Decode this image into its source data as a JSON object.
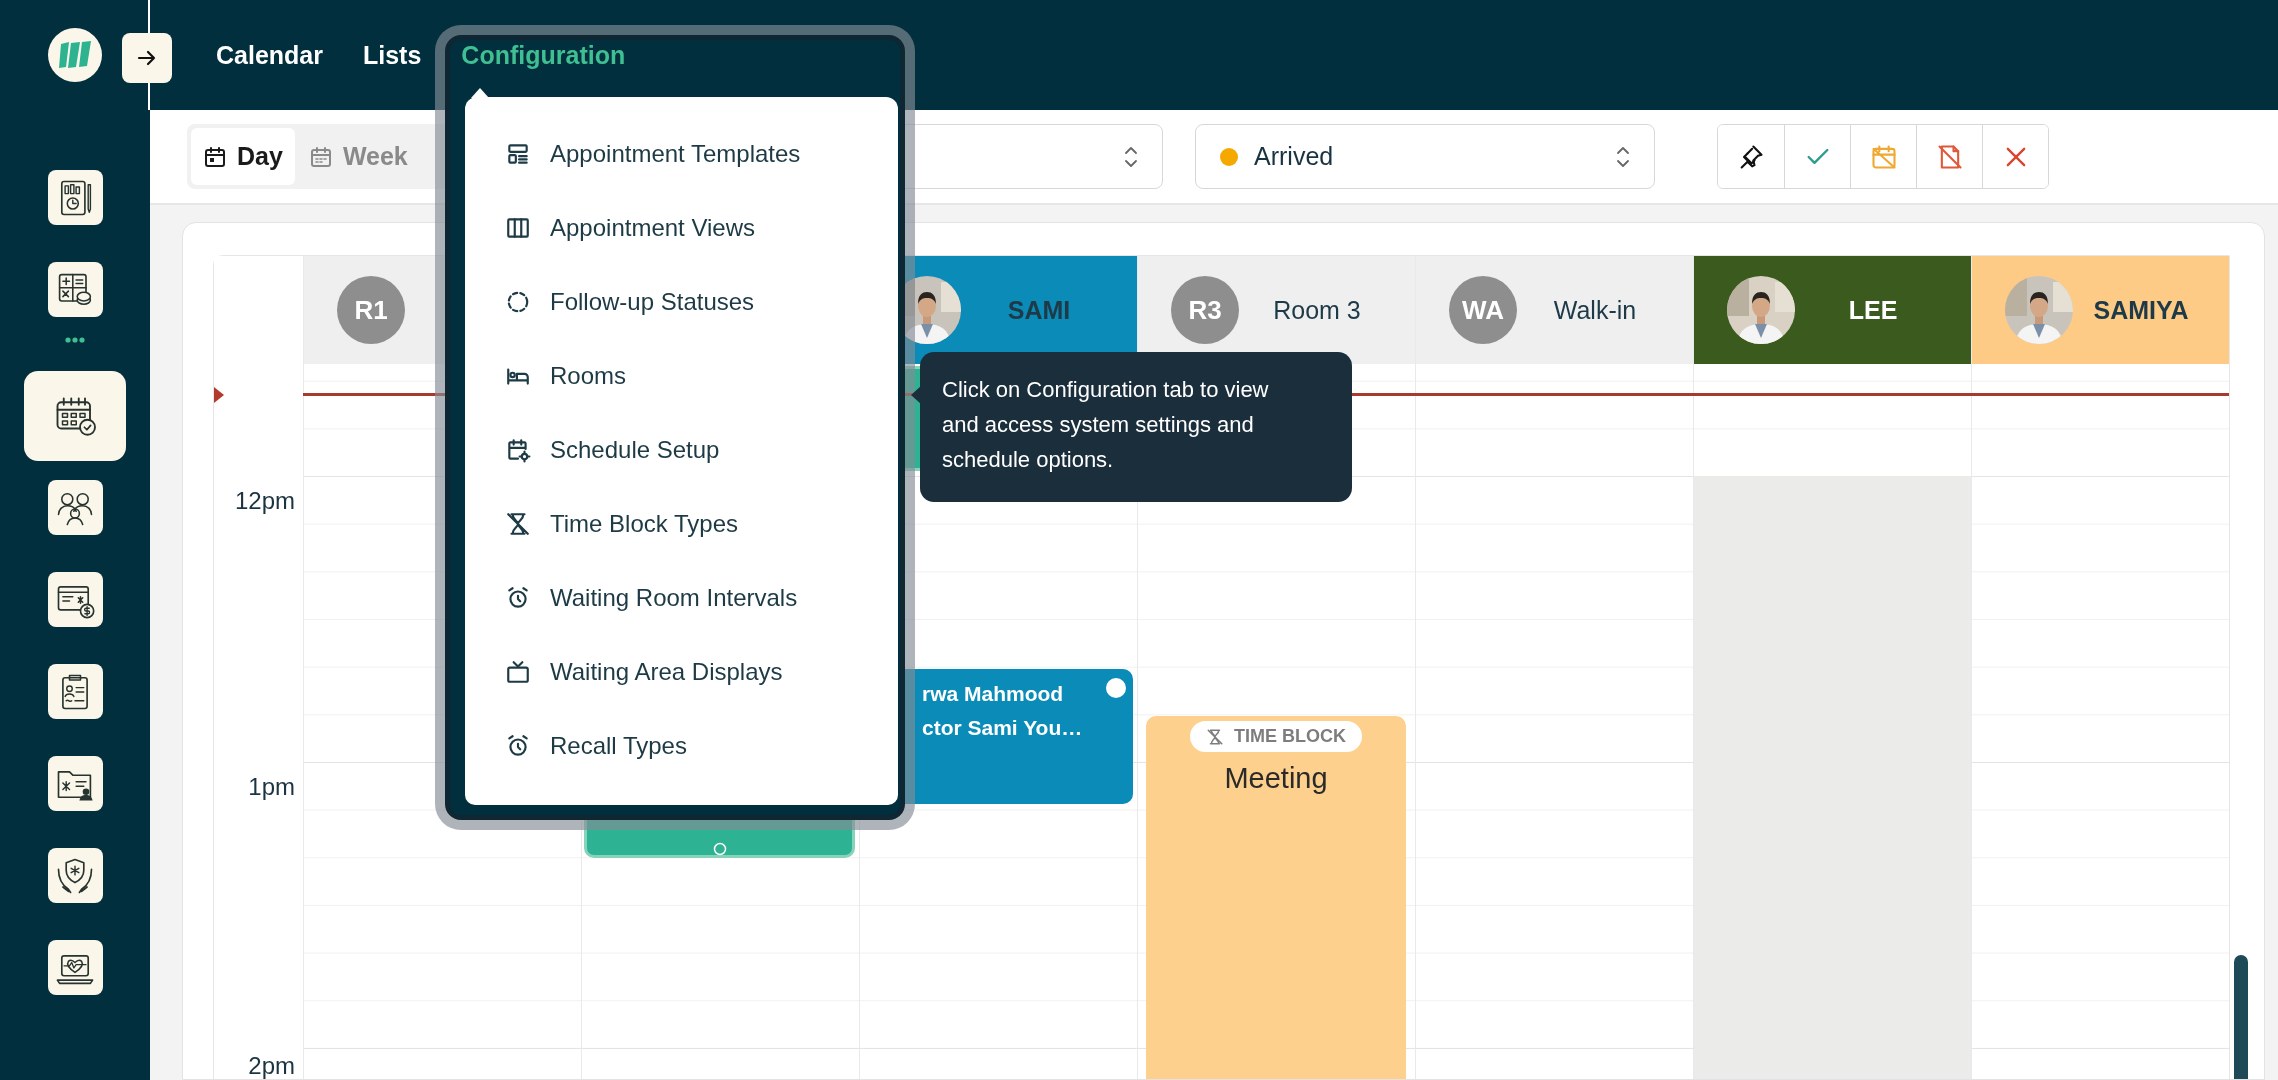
{
  "top_nav": [
    {
      "label": "Calendar",
      "selected": false
    },
    {
      "label": "Lists",
      "selected": false
    },
    {
      "label": "Configuration",
      "selected": true
    }
  ],
  "sidebar": {
    "items": [
      {
        "kind": "tile",
        "selected": false
      },
      {
        "kind": "tile",
        "selected": false
      },
      {
        "kind": "more"
      },
      {
        "kind": "tile",
        "selected": true
      },
      {
        "kind": "tile",
        "selected": false
      },
      {
        "kind": "tile",
        "selected": false
      },
      {
        "kind": "tile",
        "selected": false
      },
      {
        "kind": "tile",
        "selected": false
      },
      {
        "kind": "tile",
        "selected": false
      },
      {
        "kind": "tile",
        "selected": false
      }
    ]
  },
  "view_switch": [
    {
      "label": "Day",
      "selected": true
    },
    {
      "label": "Week",
      "selected": false
    }
  ],
  "filters": [
    {
      "kind": "select"
    },
    {
      "kind": "status_select",
      "value": "Arrived",
      "color": "#f5a800"
    }
  ],
  "actions": [
    {
      "kind": "pin"
    },
    {
      "kind": "confirm"
    },
    {
      "kind": "reschedule"
    },
    {
      "kind": "no_show"
    },
    {
      "kind": "cancel"
    }
  ],
  "calendar": {
    "times": [
      "12pm",
      "1pm",
      "2pm"
    ],
    "columns": [
      {
        "kind": "room",
        "badge": "R1",
        "unavailable": false
      },
      {
        "kind": "room",
        "events": [
          {
            "kind": "appointment",
            "color": "#2db394"
          }
        ]
      },
      {
        "kind": "provider",
        "name": "SAMI",
        "color": "#0b8cb8",
        "unavailable": false,
        "events": [
          {
            "kind": "appointment",
            "color": "#2db394"
          },
          {
            "kind": "appointment",
            "color": "#0b8cb8",
            "title": "rwa Mahmood",
            "subtitle": "ctor Sami You…"
          }
        ]
      },
      {
        "kind": "room",
        "badge": "R3",
        "name": "Room 3",
        "unavailable": false,
        "events": [
          {
            "kind": "time_block",
            "tag": "TIME BLOCK",
            "title": "Meeting"
          }
        ]
      },
      {
        "kind": "room",
        "badge": "WA",
        "name": "Walk-in",
        "unavailable": false
      },
      {
        "kind": "provider",
        "name": "LEE",
        "color": "#3b5a1e",
        "unavailable": true
      },
      {
        "kind": "provider",
        "name": "SAMIYA",
        "color": "#fdcb85",
        "unavailable": false
      }
    ]
  },
  "config_menu": {
    "items": [
      {
        "label": "Appointment Templates"
      },
      {
        "label": "Appointment Views"
      },
      {
        "label": "Follow-up Statuses"
      },
      {
        "label": "Rooms"
      },
      {
        "label": "Schedule Setup"
      },
      {
        "label": "Time Block Types"
      },
      {
        "label": "Waiting Room Intervals"
      },
      {
        "label": "Waiting Area Displays"
      },
      {
        "label": "Recall Types"
      }
    ]
  },
  "tooltip": {
    "text": "Click on Configuration tab to view and access system settings and schedule options."
  }
}
